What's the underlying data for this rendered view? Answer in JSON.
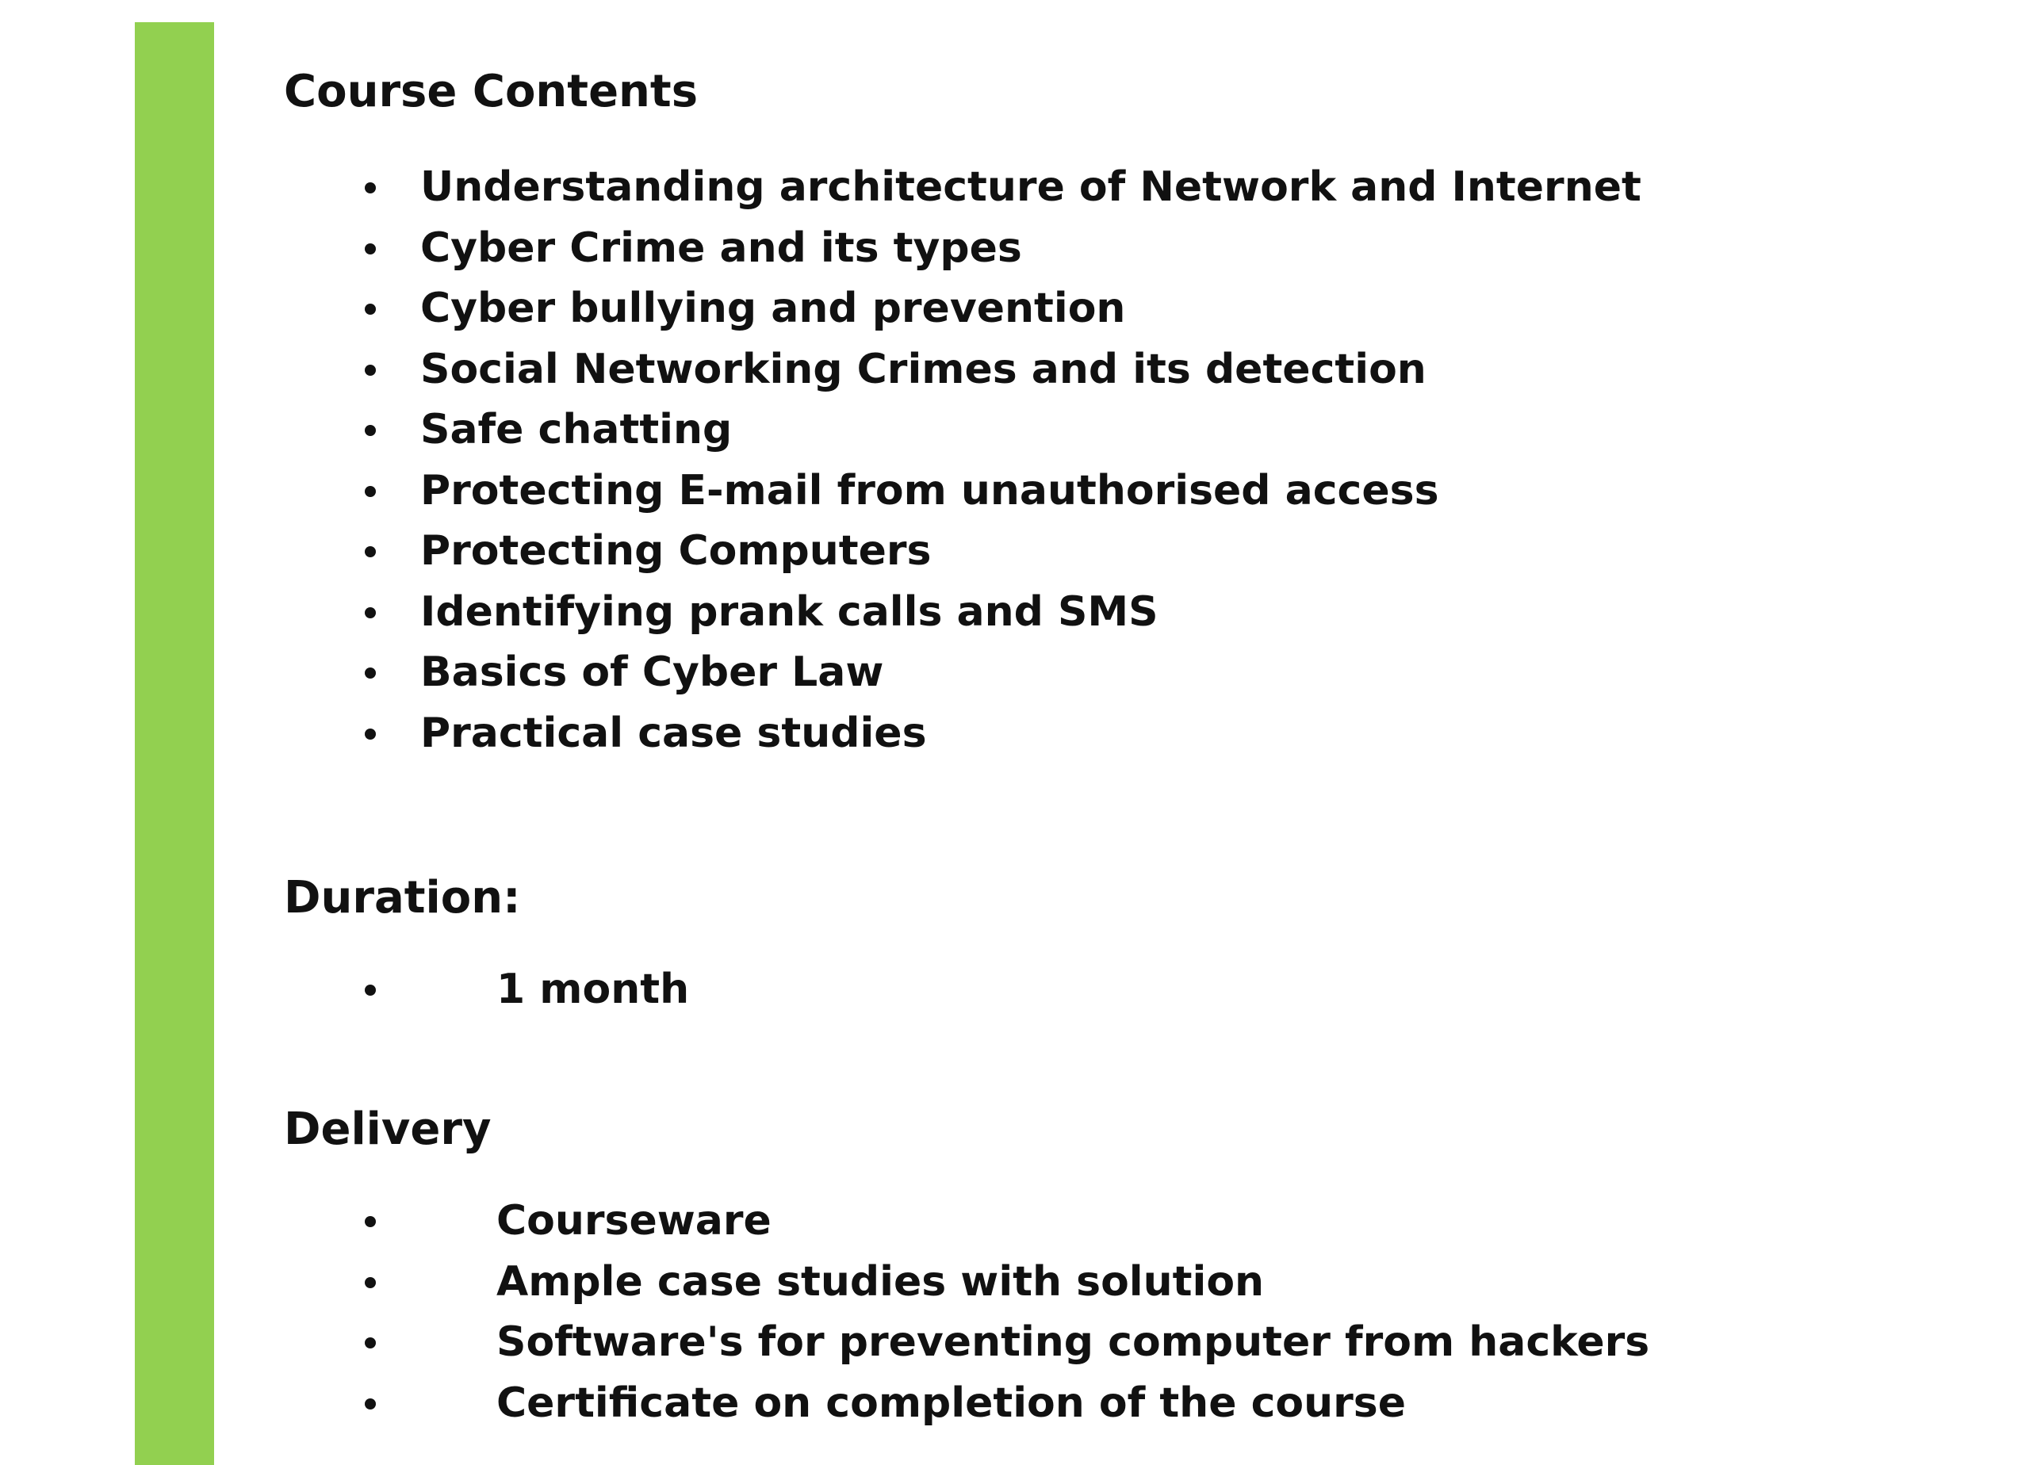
{
  "sections": {
    "contents": {
      "heading": "Course Contents",
      "items": [
        "Understanding architecture of Network and Internet",
        "Cyber Crime and its types",
        "Cyber bullying and prevention",
        "Social Networking Crimes and its detection",
        "Safe chatting",
        "Protecting E-mail from unauthorised access",
        "Protecting Computers",
        "Identifying prank calls and SMS",
        "Basics of Cyber Law",
        "Practical case studies"
      ]
    },
    "duration": {
      "heading": "Duration:",
      "items": [
        "1 month"
      ]
    },
    "delivery": {
      "heading": "Delivery",
      "items": [
        "Courseware",
        "Ample case studies with solution",
        "Software's for preventing computer from hackers",
        "Certificate on completion of the course"
      ]
    }
  },
  "colors": {
    "accent_bar": "#92d050",
    "text": "#111111",
    "background": "#ffffff"
  }
}
